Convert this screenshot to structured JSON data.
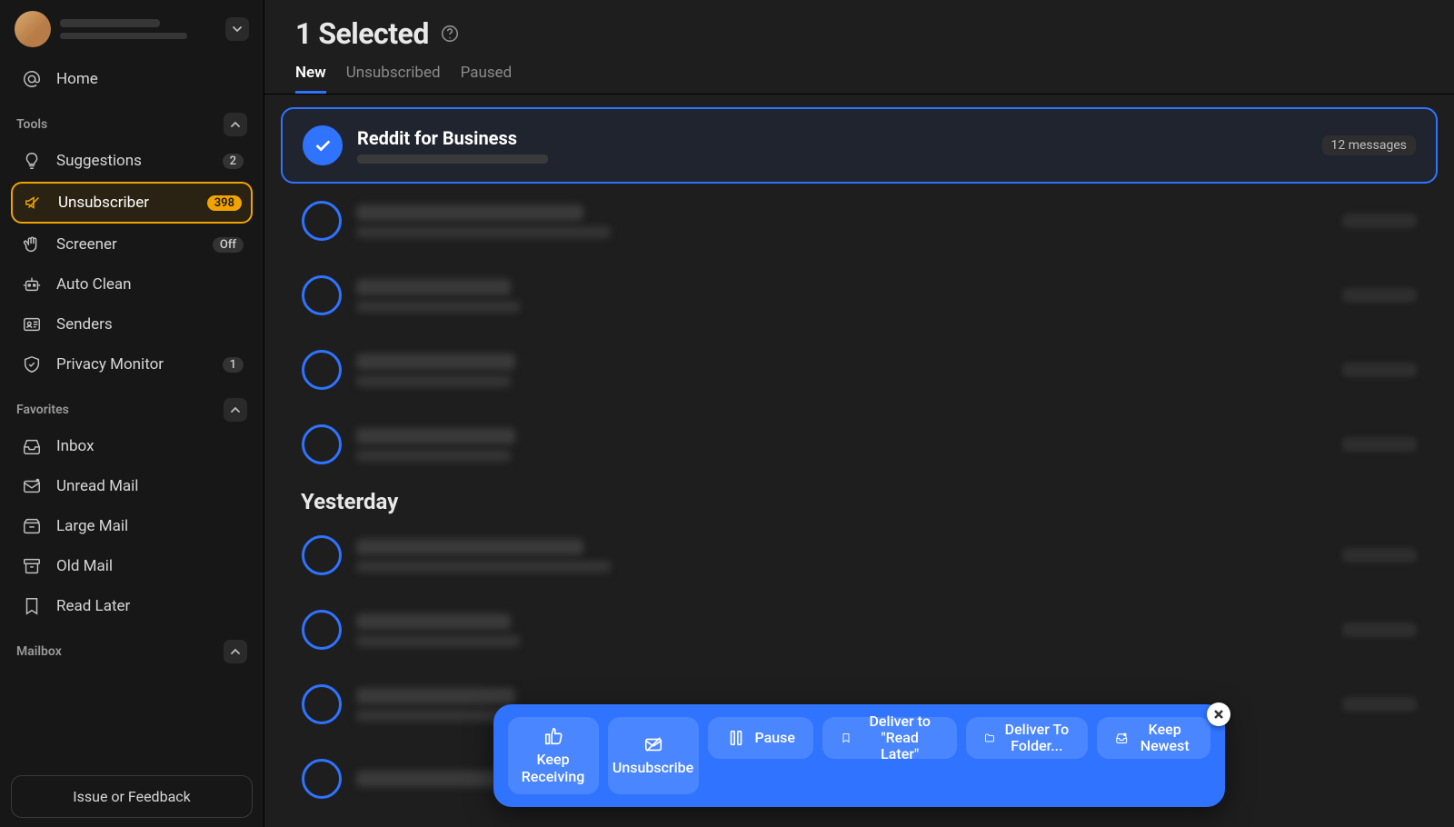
{
  "sidebar": {
    "home": "Home",
    "sections": {
      "tools": "Tools",
      "favorites": "Favorites",
      "mailbox": "Mailbox"
    },
    "tools": {
      "suggestions": {
        "label": "Suggestions",
        "badge": "2"
      },
      "unsubscriber": {
        "label": "Unsubscriber",
        "badge": "398"
      },
      "screener": {
        "label": "Screener",
        "badge": "Off"
      },
      "autoclean": {
        "label": "Auto Clean"
      },
      "senders": {
        "label": "Senders"
      },
      "privacy": {
        "label": "Privacy Monitor",
        "badge": "1"
      }
    },
    "favorites": {
      "inbox": "Inbox",
      "unread": "Unread Mail",
      "large": "Large Mail",
      "old": "Old Mail",
      "readlater": "Read Later"
    },
    "feedback": "Issue or Feedback"
  },
  "header": {
    "title": "1 Selected",
    "tabs": {
      "new": "New",
      "unsubscribed": "Unsubscribed",
      "paused": "Paused"
    }
  },
  "rows": {
    "selected": {
      "name": "Reddit for Business",
      "count": "12 messages"
    },
    "section_yesterday": "Yesterday"
  },
  "actionbar": {
    "keep_receiving": "Keep\nReceiving",
    "unsubscribe": "Unsubscribe",
    "pause": "Pause",
    "deliver_readlater": "Deliver to \"Read Later\"",
    "deliver_folder": "Deliver To Folder...",
    "keep_newest": "Keep Newest"
  }
}
